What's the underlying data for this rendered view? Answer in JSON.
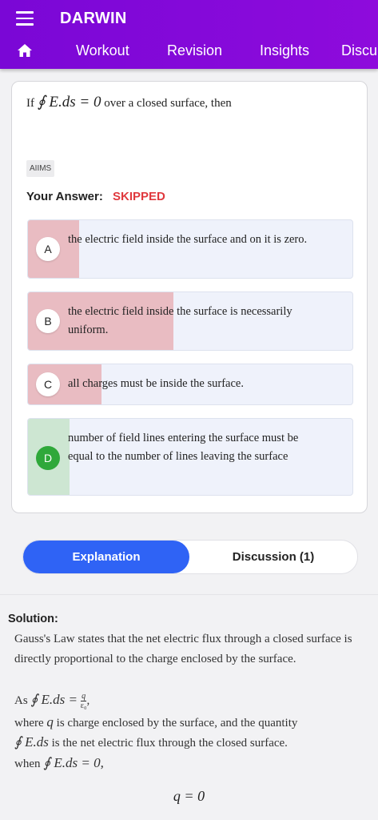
{
  "app": {
    "title": "DARWIN"
  },
  "tabs": [
    "Workout",
    "Revision",
    "Insights",
    "Discu"
  ],
  "question": {
    "prefix": "If",
    "math": "∮ E.ds = 0",
    "suffix": "over a closed surface, then",
    "tag": "AIIMS"
  },
  "answer": {
    "label": "Your Answer:",
    "value": "SKIPPED",
    "value_color": "#e0393e"
  },
  "options": [
    {
      "letter": "A",
      "text": "the electric field inside the surface and on it is zero.",
      "percent": 16,
      "correct": false
    },
    {
      "letter": "B",
      "text": "the electric field inside the surface is necessarily uniform.",
      "percent": 45,
      "correct": false
    },
    {
      "letter": "C",
      "text": "all charges must be inside the surface.",
      "percent": 23,
      "correct": false
    },
    {
      "letter": "D",
      "text": "number of field lines entering the surface must be equal to the number of lines leaving the surface",
      "percent": 13,
      "correct": true
    }
  ],
  "toggle": {
    "explanation": "Explanation",
    "discussion": "Discussion (1)"
  },
  "solution": {
    "label": "Solution:",
    "line1": "Gauss's Law states that the net electric flux through a closed surface is directly proportional to the charge enclosed by the surface.",
    "as_prefix": "As",
    "as_math": "∮ E.ds =",
    "frac_num": "q",
    "frac_den": "ε₀",
    "comma": ",",
    "where_prefix": "where",
    "where_q": "q",
    "where_rest": "is charge enclosed by the surface, and the quantity",
    "flux_math": "∮ E.ds",
    "flux_rest": "is the net electric flux through the closed surface.",
    "when_prefix": "when",
    "when_math": "∮ E.ds = 0,",
    "result": "q = 0"
  },
  "colors": {
    "appbar": "#7a07d6",
    "active_toggle": "#2f63f5",
    "wrong_fill": "#e9bcc2",
    "correct_fill": "#cde6d2",
    "correct_circle": "#2fa83a"
  }
}
